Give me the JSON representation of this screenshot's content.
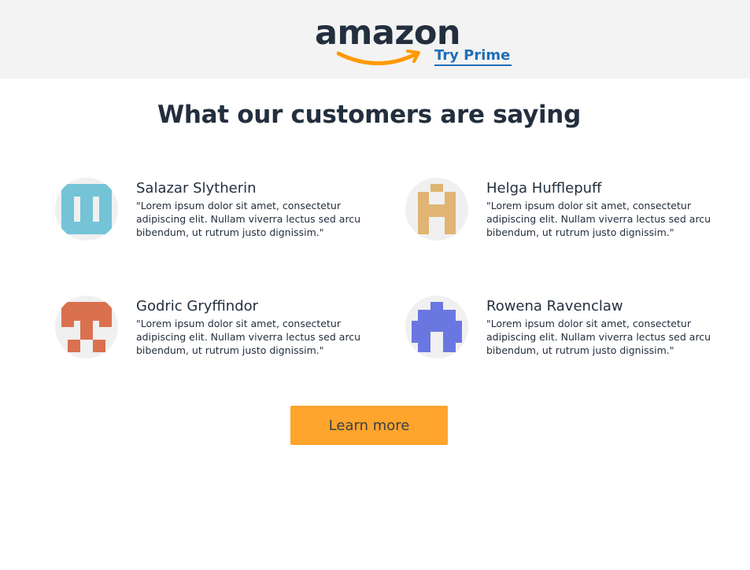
{
  "header": {
    "logo_text": "amazon",
    "try_prime_label": "Try Prime"
  },
  "main": {
    "heading": "What our customers are saying",
    "testimonials": [
      {
        "name": "Salazar Slytherin",
        "quote": "\"Lorem ipsum dolor sit amet, consectetur adipiscing elit. Nullam viverra lectus sed arcu bibendum, ut rutrum justo dignissim.\"",
        "avatar_color": "#74c3d6"
      },
      {
        "name": "Helga Hufflepuff",
        "quote": "\"Lorem ipsum dolor sit amet, consectetur adipiscing elit. Nullam viverra lectus sed arcu bibendum, ut rutrum justo dignissim.\"",
        "avatar_color": "#e0b473"
      },
      {
        "name": "Godric Gryffindor",
        "quote": "\"Lorem ipsum dolor sit amet, consectetur adipiscing elit. Nullam viverra lectus sed arcu bibendum, ut rutrum justo dignissim.\"",
        "avatar_color": "#d9714f"
      },
      {
        "name": "Rowena Ravenclaw",
        "quote": "\"Lorem ipsum dolor sit amet, consectetur adipiscing elit. Nullam viverra lectus sed arcu bibendum, ut rutrum justo dignissim.\"",
        "avatar_color": "#6b77e0"
      }
    ],
    "cta_label": "Learn more"
  },
  "colors": {
    "header_bg": "#f3f3f3",
    "brand_orange": "#ff9900",
    "link_blue": "#1e6fb8",
    "button_bg": "#ffa42c",
    "text_dark": "#232f3e"
  }
}
